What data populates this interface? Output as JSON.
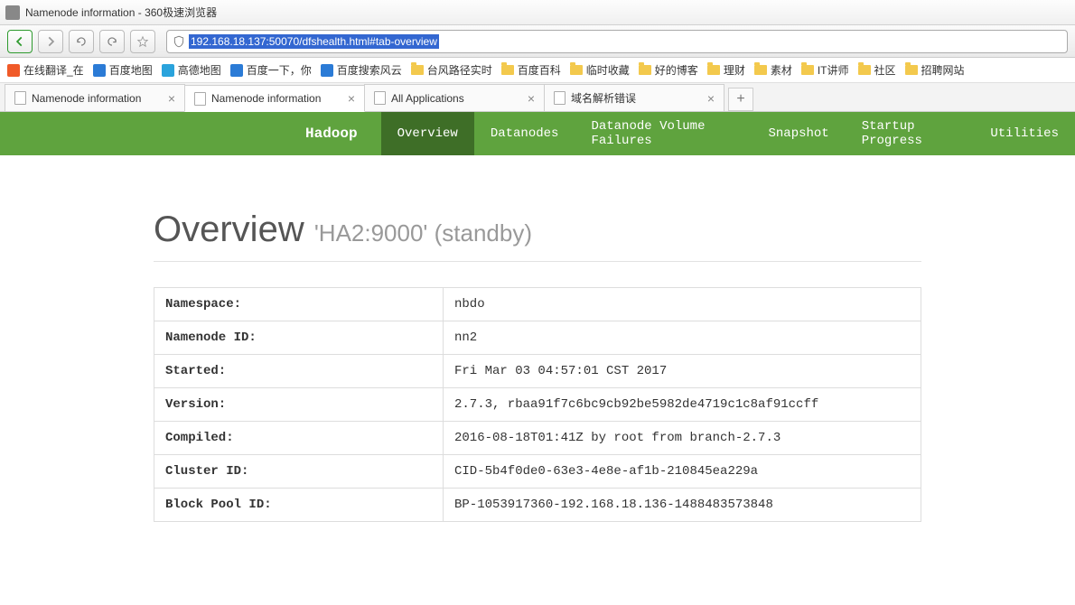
{
  "window": {
    "title": "Namenode information - 360极速浏览器"
  },
  "url": "192.168.18.137:50070/dfshealth.html#tab-overview",
  "bookmarks": [
    {
      "label": "在线翻译_在",
      "color": "#f05a28"
    },
    {
      "label": "百度地图",
      "color": "#2b7bd6"
    },
    {
      "label": "高德地图",
      "color": "#2aa3dc"
    },
    {
      "label": "百度一下，你",
      "color": "#2b7bd6"
    },
    {
      "label": "百度搜索风云",
      "color": "#2b7bd6"
    },
    {
      "label": "台风路径实时",
      "folder": true
    },
    {
      "label": "百度百科",
      "folder": true
    },
    {
      "label": "临时收藏",
      "folder": true
    },
    {
      "label": "好的博客",
      "folder": true
    },
    {
      "label": "理财",
      "folder": true
    },
    {
      "label": "素材",
      "folder": true
    },
    {
      "label": "IT讲师",
      "folder": true
    },
    {
      "label": "社区",
      "folder": true
    },
    {
      "label": "招聘网站",
      "folder": true
    }
  ],
  "tabs": [
    {
      "label": "Namenode information",
      "active": false
    },
    {
      "label": "Namenode information",
      "active": true
    },
    {
      "label": "All Applications",
      "active": false
    },
    {
      "label": "域名解析错误",
      "active": false
    }
  ],
  "hnav": {
    "brand": "Hadoop",
    "items": [
      {
        "label": "Overview",
        "active": true
      },
      {
        "label": "Datanodes",
        "active": false
      },
      {
        "label": "Datanode Volume Failures",
        "active": false
      },
      {
        "label": "Snapshot",
        "active": false
      },
      {
        "label": "Startup Progress",
        "active": false
      },
      {
        "label": "Utilities",
        "active": false
      }
    ]
  },
  "page": {
    "heading": "Overview",
    "subheading": "'HA2:9000' (standby)",
    "rows": [
      {
        "k": "Namespace:",
        "v": "nbdo"
      },
      {
        "k": "Namenode ID:",
        "v": "nn2"
      },
      {
        "k": "Started:",
        "v": "Fri Mar 03 04:57:01 CST 2017"
      },
      {
        "k": "Version:",
        "v": "2.7.3, rbaa91f7c6bc9cb92be5982de4719c1c8af91ccff"
      },
      {
        "k": "Compiled:",
        "v": "2016-08-18T01:41Z by root from branch-2.7.3"
      },
      {
        "k": "Cluster ID:",
        "v": "CID-5b4f0de0-63e3-4e8e-af1b-210845ea229a"
      },
      {
        "k": "Block Pool ID:",
        "v": "BP-1053917360-192.168.18.136-1488483573848"
      }
    ]
  }
}
